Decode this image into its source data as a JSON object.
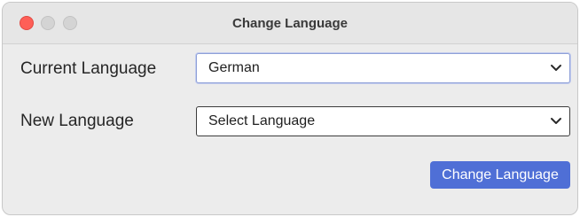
{
  "window": {
    "title": "Change Language"
  },
  "form": {
    "current_language": {
      "label": "Current Language",
      "value": "German"
    },
    "new_language": {
      "label": "New Language",
      "value": "Select Language"
    },
    "submit_label": "Change Language"
  },
  "colors": {
    "close": "#fe5f57",
    "inactive_traffic": "#d4d4d4",
    "accent": "#4f6fd6",
    "focus_border": "#8ea0d8"
  }
}
